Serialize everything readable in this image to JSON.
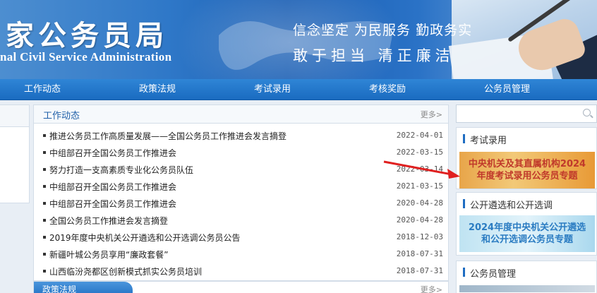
{
  "header": {
    "title": "家公务员局",
    "subtitle": "nal Civil Service Administration",
    "slogan_top": "信念坚定 为民服务 勤政务实",
    "slogan_bottom": "敢于担当 清正廉洁"
  },
  "nav": {
    "items": [
      {
        "label": "工作动态"
      },
      {
        "label": "政策法规"
      },
      {
        "label": "考试录用"
      },
      {
        "label": "考核奖励"
      },
      {
        "label": "公务员管理"
      }
    ]
  },
  "news": {
    "title": "工作动态",
    "more_label": "更多>",
    "items": [
      {
        "text": "推进公务员工作高质量发展——全国公务员工作推进会发言摘登",
        "date": "2022-04-01"
      },
      {
        "text": "中组部召开全国公务员工作推进会",
        "date": "2022-03-15"
      },
      {
        "text": "努力打造一支高素质专业化公务员队伍",
        "date": "2022-03-14"
      },
      {
        "text": "中组部召开全国公务员工作推进会",
        "date": "2021-03-15"
      },
      {
        "text": "中组部召开全国公务员工作推进会",
        "date": "2020-04-28"
      },
      {
        "text": "全国公务员工作推进会发言摘登",
        "date": "2020-04-28"
      },
      {
        "text": "2019年度中央机关公开遴选和公开选调公务员公告",
        "date": "2018-12-03"
      },
      {
        "text": "新疆叶城公务员享用“廉政套餐”",
        "date": "2018-07-31"
      },
      {
        "text": "山西临汾尧都区创新模式抓实公务员培训",
        "date": "2018-07-31"
      }
    ]
  },
  "news2": {
    "title": "政策法规",
    "more_label": "更多>"
  },
  "sidebar": {
    "search_placeholder": "",
    "exam": {
      "title": "考试录用",
      "promo_line1": "中央机关及其直属机构2024",
      "promo_line2": "年度考试录用公务员专题"
    },
    "selection": {
      "title": "公开遴选和公开选调",
      "promo_line1": "2024年度中央机关公开遴选",
      "promo_line2": "和公开选调公务员专题"
    },
    "management": {
      "title": "公务员管理"
    }
  },
  "colors": {
    "nav_blue": "#1f6dc2",
    "annotation_red": "#e02020"
  }
}
